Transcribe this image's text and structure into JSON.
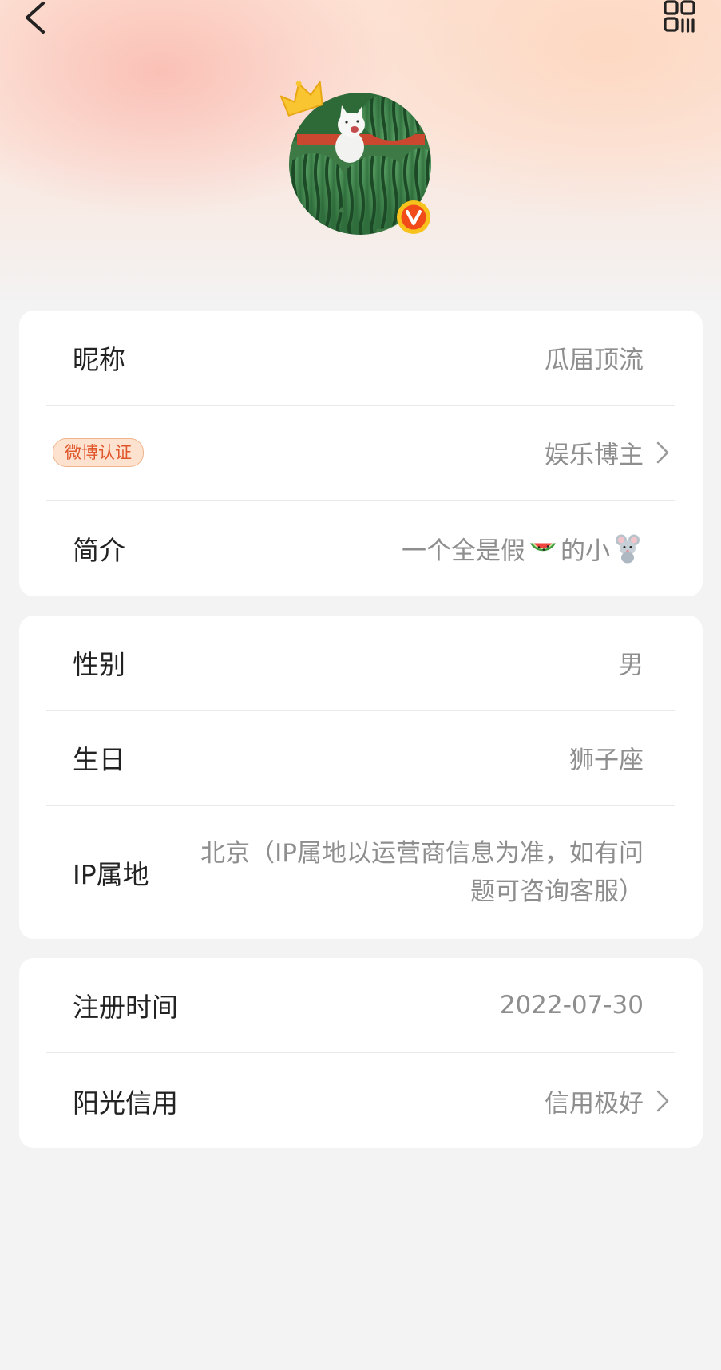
{
  "header": {
    "back_icon": "chevron-left-icon",
    "qr_icon": "qr-code-icon"
  },
  "profile": {
    "avatar_desc_icon": "avatar-watermelon-cat",
    "crown_icon": "crown-icon",
    "verified_icon": "verified-v-icon"
  },
  "section1": {
    "nickname_label": "昵称",
    "nickname_value": "瓜届顶流",
    "cert_badge": "微博认证",
    "cert_value": "娱乐博主",
    "bio_label": "简介",
    "bio_text_1": "一个全是假",
    "bio_text_2": "的小",
    "bio_emoji_1": "watermelon-emoji",
    "bio_emoji_2": "mouse-emoji"
  },
  "section2": {
    "gender_label": "性别",
    "gender_value": "男",
    "birthday_label": "生日",
    "birthday_value": "狮子座",
    "ip_label": "IP属地",
    "ip_value": "北京（IP属地以运营商信息为准，如有问题可咨询客服）"
  },
  "section3": {
    "register_label": "注册时间",
    "register_value": "2022-07-30",
    "credit_label": "阳光信用",
    "credit_value": "信用极好"
  },
  "colors": {
    "label": "#222222",
    "value": "#8e8e8e",
    "badge_text": "#e0562b",
    "badge_bg": "#fde2cf",
    "verified": "#f24b1a",
    "page_bg": "#f3f3f3"
  }
}
